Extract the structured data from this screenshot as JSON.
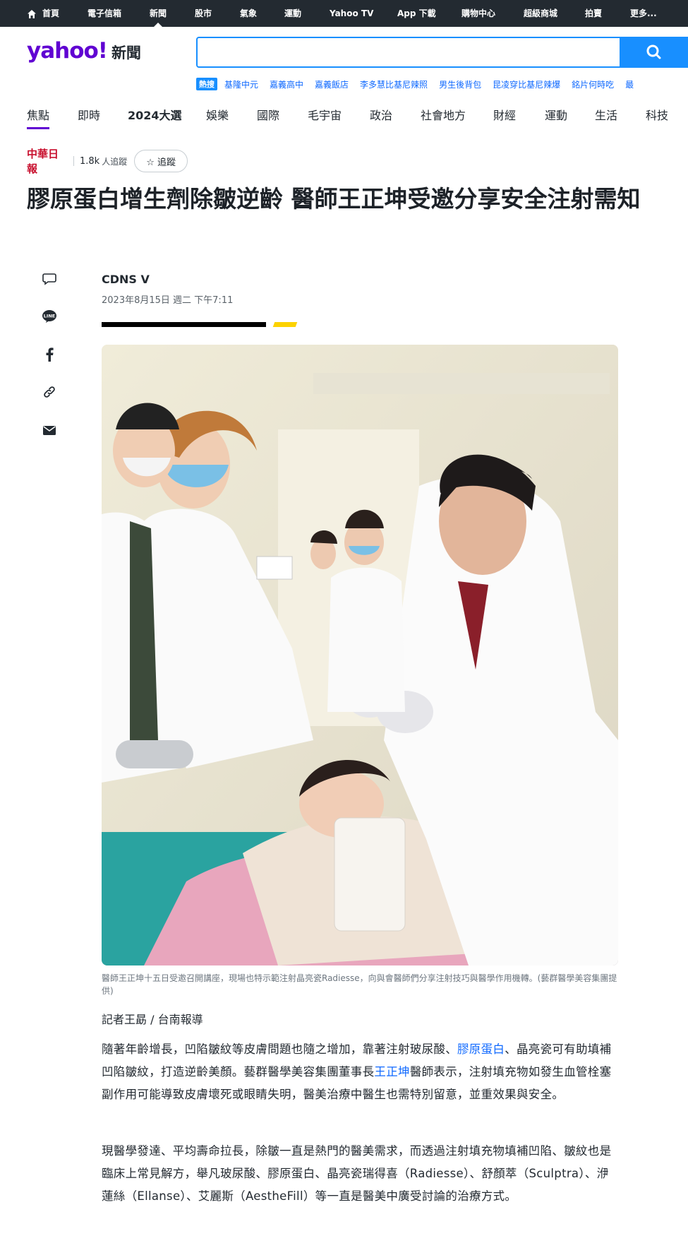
{
  "topnav": {
    "items": [
      "首頁",
      "電子信箱",
      "新聞",
      "股市",
      "氣象",
      "運動",
      "Yahoo TV",
      "App 下載",
      "購物中心",
      "超級商城",
      "拍賣",
      "更多..."
    ],
    "active": "新聞"
  },
  "brand": {
    "logo": "yahoo!",
    "section": "新聞"
  },
  "search": {
    "placeholder": "",
    "value": ""
  },
  "hot": {
    "badge": "熱搜",
    "terms": [
      "基隆中元",
      "嘉義高中",
      "嘉義飯店",
      "李多慧比基尼辣照",
      "男生後背包",
      "昆凌穿比基尼辣爆",
      "銘片何時吃",
      "最"
    ]
  },
  "categories": {
    "items": [
      "焦點",
      "即時",
      "2024大選",
      "娛樂",
      "國際",
      "毛宇宙",
      "政治",
      "社會地方",
      "財經",
      "運動",
      "生活",
      "科技"
    ],
    "active": "焦點"
  },
  "source": {
    "name": "中華日報",
    "followers": "1.8k",
    "followers_label": "人追蹤",
    "follow_label": "☆ 追蹤"
  },
  "article": {
    "title": "膠原蛋白增生劑除皺逆齡 醫師王正坤受邀分享安全注射需知",
    "author": "CDNS V",
    "date": "2023年8月15日 週二 下午7:11",
    "image_caption": "醫師王正坤十五日受邀召開講座，現場也特示範注射晶亮瓷Radiesse，向與會醫師們分享注射技巧與醫學作用機轉。(藝群醫學美容集團提供)",
    "byline": "記者王勗 / 台南報導",
    "p1_a": "隨著年齡增長，凹陷皺紋等皮膚問題也隨之增加，靠著注射玻尿酸、",
    "p1_link1": "膠原蛋白",
    "p1_b": "、晶亮瓷可有助填補凹陷皺紋，打造逆齡美顏。藝群醫學美容集團董事長",
    "p1_link2": "王正坤",
    "p1_c": "醫師表示，注射填充物如發生血管栓塞副作用可能導致皮膚壞死或眼睛失明，醫美治療中醫生也需特別留意，並重效果與安全。",
    "p2": "現醫學發達、平均壽命拉長，除皺一直是熱門的醫美需求，而透過注射填充物填補凹陷、皺紋也是臨床上常見解方，舉凡玻尿酸、膠原蛋白、晶亮瓷瑞得喜（Radiesse）、舒顏萃（Sculptra）、洢蓮絲（Ellanse）、艾麗斯（AestheFill）等一直是醫美中廣受討論的治療方式。"
  },
  "share_icons": [
    "comment-icon",
    "line-icon",
    "facebook-icon",
    "link-icon",
    "mail-icon"
  ],
  "colors": {
    "brand": "#6001d2",
    "accent": "#188fff",
    "topbar": "#232a31",
    "link": "#0f69ff"
  }
}
